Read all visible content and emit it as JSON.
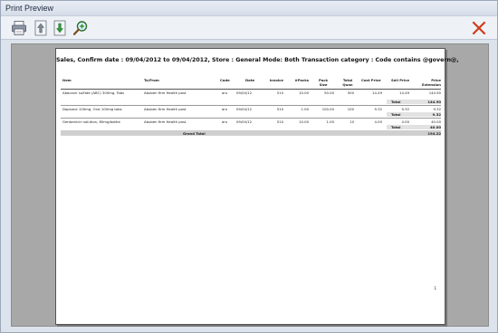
{
  "window": {
    "title": "Print Preview"
  },
  "toolbar": {
    "icons": [
      "print-icon",
      "page-up-icon",
      "page-down-icon",
      "zoom-icon",
      "close-icon"
    ],
    "close_color": "#d23a1a"
  },
  "report": {
    "title": "Sales, Confirm date : 09/04/2012 to 09/04/2012,  Store : General Mode: Both Transaction category : Code contains  @govern@,",
    "headers": {
      "item": "Item",
      "tofrom": "To/From",
      "code": "Code",
      "date": "Date",
      "invoice": "Invoice",
      "packs": "#Packs",
      "pack_size_1": "Pack",
      "pack_size_2": "Size",
      "total_quan_1": "Total",
      "total_quan_2": "Quan",
      "cost_price": "Cost Price",
      "sell_price": "Sell Price",
      "price_ext_1": "Price",
      "price_ext_2": "Extension"
    },
    "rows": [
      {
        "item": "Abacavir sulfate (ABC) 300mg, Tabs",
        "tofrom": "Abuben firm Health post",
        "code": "aru",
        "date": "09/04/12",
        "invoice": "510",
        "packs": "10.00",
        "pack_size": "50.00",
        "total_quan": "500",
        "cost_price": "14.49",
        "sell_price": "14.49",
        "ext": "144.90",
        "total_label": "Total",
        "total_value": "144.90"
      },
      {
        "item": "Dapsone 100mg, Oral 100mg tabs",
        "tofrom": "Abuben firm Health post",
        "code": "aru",
        "date": "09/04/12",
        "invoice": "510",
        "packs": "1.00",
        "pack_size": "100.00",
        "total_quan": "100",
        "cost_price": "9.32",
        "sell_price": "9.32",
        "ext": "9.32",
        "total_label": "Total",
        "total_value": "9.32"
      },
      {
        "item": "Gentamicin solution, 80mg/bottle",
        "tofrom": "Abuben firm Health post",
        "code": "aru",
        "date": "09/04/12",
        "invoice": "510",
        "packs": "10.00",
        "pack_size": "1.00",
        "total_quan": "10",
        "cost_price": "4.00",
        "sell_price": "4.00",
        "ext": "40.00",
        "total_label": "Total",
        "total_value": "40.00"
      }
    ],
    "grand_total_label": "Grand Total",
    "grand_total_value": "194.22",
    "page_number": "1"
  }
}
